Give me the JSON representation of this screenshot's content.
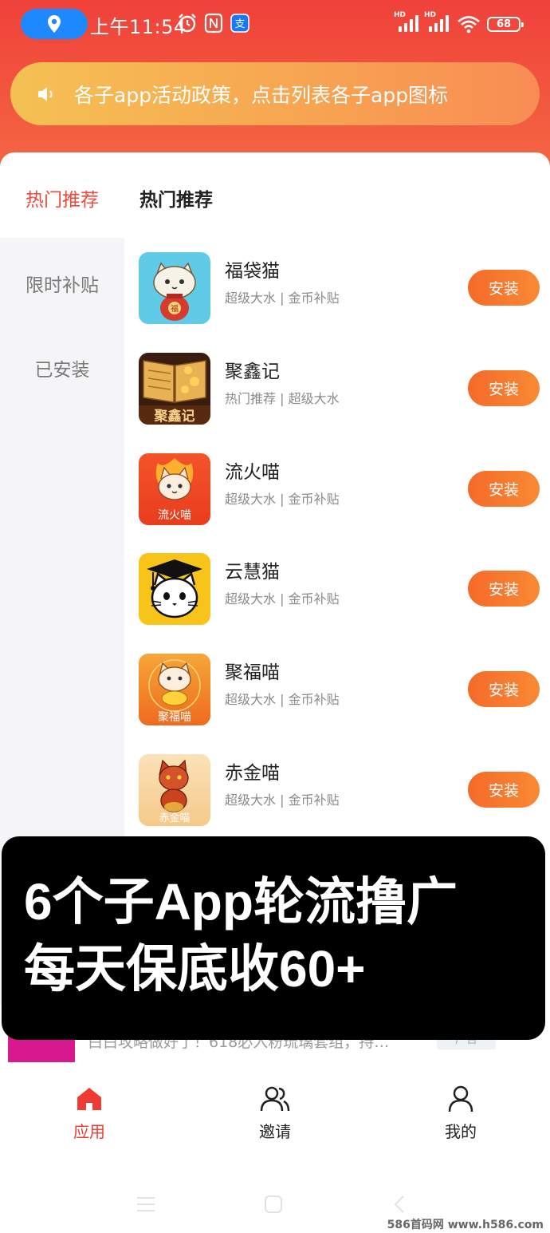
{
  "status_bar": {
    "time": "上午11:54",
    "battery": "68",
    "hd1": "HD",
    "hd2": "HD"
  },
  "notice": {
    "text": "各子app活动政策，点击列表各子app图标"
  },
  "sidebar": {
    "items": [
      {
        "label": "热门推荐",
        "active": true
      },
      {
        "label": "限时补贴",
        "active": false
      },
      {
        "label": "已安装",
        "active": false
      }
    ]
  },
  "section_title": "热门推荐",
  "apps": [
    {
      "name": "福袋猫",
      "tags": "超级大水 | 金币补贴",
      "button": "安装",
      "icon": "lucky-bag-cat-icon"
    },
    {
      "name": "聚鑫记",
      "tags": "热门推荐 | 超级大水",
      "button": "安装",
      "icon": "gold-book-icon",
      "icon_label": "聚鑫记"
    },
    {
      "name": "流火喵",
      "tags": "超级大水 | 金币补贴",
      "button": "安装",
      "icon": "fire-cat-icon",
      "icon_label": "流火喵"
    },
    {
      "name": "云慧猫",
      "tags": "超级大水 | 金币补贴",
      "button": "安装",
      "icon": "graduate-cat-icon"
    },
    {
      "name": "聚福喵",
      "tags": "超级大水 | 金币补贴",
      "button": "安装",
      "icon": "fortune-cat-icon",
      "icon_label": "聚福喵"
    },
    {
      "name": "赤金喵",
      "tags": "超级大水 | 金币补贴",
      "button": "安装",
      "icon": "golden-tiger-cat-icon",
      "icon_label": "赤金喵"
    }
  ],
  "overlay": {
    "line1": "6个子App轮流撸广",
    "line2": "每天保底收60+"
  },
  "ad": {
    "text": "白白攻略做好了！618必入粉琉璃套组，持…",
    "badge": "广告"
  },
  "bottom_nav": [
    {
      "label": "应用",
      "icon": "home-icon",
      "active": true
    },
    {
      "label": "邀请",
      "icon": "users-icon",
      "active": false
    },
    {
      "label": "我的",
      "icon": "user-icon",
      "active": false
    }
  ],
  "watermark": "586首码网 www.h586.com",
  "colors": {
    "header_red": "#f0413a",
    "accent": "#ee4a3b",
    "button_orange": "#f56a2a"
  }
}
